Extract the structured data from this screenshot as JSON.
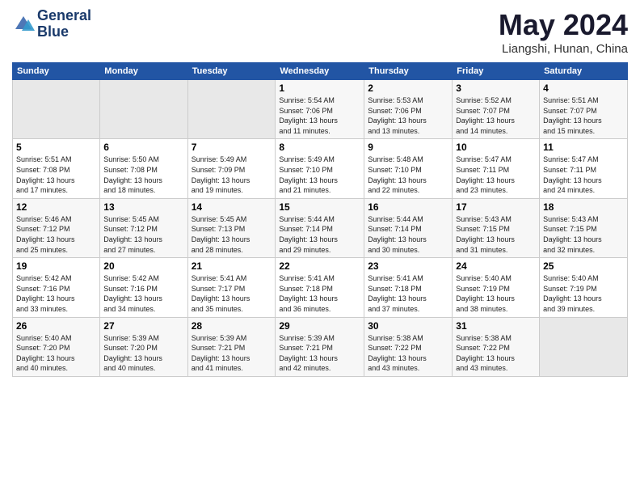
{
  "header": {
    "logo_line1": "General",
    "logo_line2": "Blue",
    "month": "May 2024",
    "location": "Liangshi, Hunan, China"
  },
  "days_of_week": [
    "Sunday",
    "Monday",
    "Tuesday",
    "Wednesday",
    "Thursday",
    "Friday",
    "Saturday"
  ],
  "weeks": [
    {
      "days": [
        {
          "num": "",
          "info": ""
        },
        {
          "num": "",
          "info": ""
        },
        {
          "num": "",
          "info": ""
        },
        {
          "num": "1",
          "info": "Sunrise: 5:54 AM\nSunset: 7:06 PM\nDaylight: 13 hours\nand 11 minutes."
        },
        {
          "num": "2",
          "info": "Sunrise: 5:53 AM\nSunset: 7:06 PM\nDaylight: 13 hours\nand 13 minutes."
        },
        {
          "num": "3",
          "info": "Sunrise: 5:52 AM\nSunset: 7:07 PM\nDaylight: 13 hours\nand 14 minutes."
        },
        {
          "num": "4",
          "info": "Sunrise: 5:51 AM\nSunset: 7:07 PM\nDaylight: 13 hours\nand 15 minutes."
        }
      ]
    },
    {
      "days": [
        {
          "num": "5",
          "info": "Sunrise: 5:51 AM\nSunset: 7:08 PM\nDaylight: 13 hours\nand 17 minutes."
        },
        {
          "num": "6",
          "info": "Sunrise: 5:50 AM\nSunset: 7:08 PM\nDaylight: 13 hours\nand 18 minutes."
        },
        {
          "num": "7",
          "info": "Sunrise: 5:49 AM\nSunset: 7:09 PM\nDaylight: 13 hours\nand 19 minutes."
        },
        {
          "num": "8",
          "info": "Sunrise: 5:49 AM\nSunset: 7:10 PM\nDaylight: 13 hours\nand 21 minutes."
        },
        {
          "num": "9",
          "info": "Sunrise: 5:48 AM\nSunset: 7:10 PM\nDaylight: 13 hours\nand 22 minutes."
        },
        {
          "num": "10",
          "info": "Sunrise: 5:47 AM\nSunset: 7:11 PM\nDaylight: 13 hours\nand 23 minutes."
        },
        {
          "num": "11",
          "info": "Sunrise: 5:47 AM\nSunset: 7:11 PM\nDaylight: 13 hours\nand 24 minutes."
        }
      ]
    },
    {
      "days": [
        {
          "num": "12",
          "info": "Sunrise: 5:46 AM\nSunset: 7:12 PM\nDaylight: 13 hours\nand 25 minutes."
        },
        {
          "num": "13",
          "info": "Sunrise: 5:45 AM\nSunset: 7:12 PM\nDaylight: 13 hours\nand 27 minutes."
        },
        {
          "num": "14",
          "info": "Sunrise: 5:45 AM\nSunset: 7:13 PM\nDaylight: 13 hours\nand 28 minutes."
        },
        {
          "num": "15",
          "info": "Sunrise: 5:44 AM\nSunset: 7:14 PM\nDaylight: 13 hours\nand 29 minutes."
        },
        {
          "num": "16",
          "info": "Sunrise: 5:44 AM\nSunset: 7:14 PM\nDaylight: 13 hours\nand 30 minutes."
        },
        {
          "num": "17",
          "info": "Sunrise: 5:43 AM\nSunset: 7:15 PM\nDaylight: 13 hours\nand 31 minutes."
        },
        {
          "num": "18",
          "info": "Sunrise: 5:43 AM\nSunset: 7:15 PM\nDaylight: 13 hours\nand 32 minutes."
        }
      ]
    },
    {
      "days": [
        {
          "num": "19",
          "info": "Sunrise: 5:42 AM\nSunset: 7:16 PM\nDaylight: 13 hours\nand 33 minutes."
        },
        {
          "num": "20",
          "info": "Sunrise: 5:42 AM\nSunset: 7:16 PM\nDaylight: 13 hours\nand 34 minutes."
        },
        {
          "num": "21",
          "info": "Sunrise: 5:41 AM\nSunset: 7:17 PM\nDaylight: 13 hours\nand 35 minutes."
        },
        {
          "num": "22",
          "info": "Sunrise: 5:41 AM\nSunset: 7:18 PM\nDaylight: 13 hours\nand 36 minutes."
        },
        {
          "num": "23",
          "info": "Sunrise: 5:41 AM\nSunset: 7:18 PM\nDaylight: 13 hours\nand 37 minutes."
        },
        {
          "num": "24",
          "info": "Sunrise: 5:40 AM\nSunset: 7:19 PM\nDaylight: 13 hours\nand 38 minutes."
        },
        {
          "num": "25",
          "info": "Sunrise: 5:40 AM\nSunset: 7:19 PM\nDaylight: 13 hours\nand 39 minutes."
        }
      ]
    },
    {
      "days": [
        {
          "num": "26",
          "info": "Sunrise: 5:40 AM\nSunset: 7:20 PM\nDaylight: 13 hours\nand 40 minutes."
        },
        {
          "num": "27",
          "info": "Sunrise: 5:39 AM\nSunset: 7:20 PM\nDaylight: 13 hours\nand 40 minutes."
        },
        {
          "num": "28",
          "info": "Sunrise: 5:39 AM\nSunset: 7:21 PM\nDaylight: 13 hours\nand 41 minutes."
        },
        {
          "num": "29",
          "info": "Sunrise: 5:39 AM\nSunset: 7:21 PM\nDaylight: 13 hours\nand 42 minutes."
        },
        {
          "num": "30",
          "info": "Sunrise: 5:38 AM\nSunset: 7:22 PM\nDaylight: 13 hours\nand 43 minutes."
        },
        {
          "num": "31",
          "info": "Sunrise: 5:38 AM\nSunset: 7:22 PM\nDaylight: 13 hours\nand 43 minutes."
        },
        {
          "num": "",
          "info": ""
        }
      ]
    }
  ]
}
